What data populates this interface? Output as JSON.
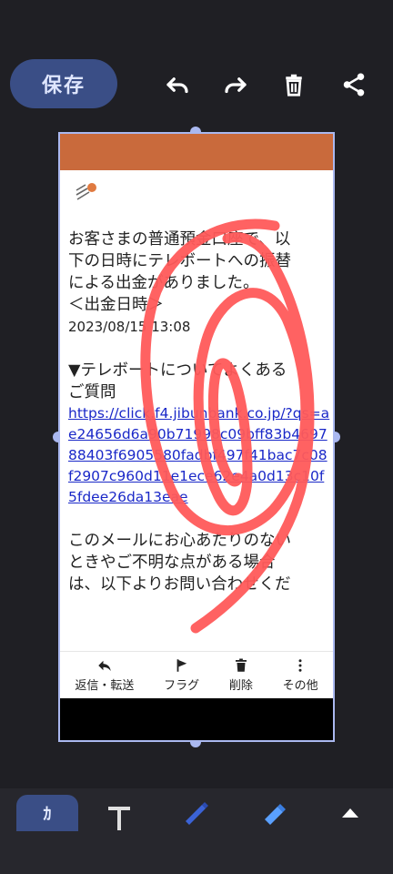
{
  "toolbar": {
    "save_label": "保存",
    "icons": [
      "undo-icon",
      "redo-icon",
      "delete-icon",
      "share-icon"
    ]
  },
  "email": {
    "header_color": "#c96a3c",
    "line1": "お客さまの普通預金口座で、以",
    "line2": "下の日時にテレボートへの振替",
    "line3": "による出金がありました。",
    "line4": "＜出金日時＞",
    "date": "2023/08/15 13:08",
    "line5": "▼テレボートについてよくある",
    "line6": "ご質問",
    "link": "https://click.f4.jibunbank.co.jp/?qs=ae24656d6a90b71998c09bff83b469788403f6905580fadbf497f41bac7c08f2907c960d11e1ece62e4a0d13c10f5fdee26da13eae",
    "line7": "このメールにお心あたりのない",
    "line8": "ときやご不明な点がある場合",
    "line9": "は、以下よりお問い合わせくだ"
  },
  "email_actions": [
    {
      "label": "返信・転送",
      "icon": "reply-icon"
    },
    {
      "label": "フラグ",
      "icon": "flag-icon"
    },
    {
      "label": "削除",
      "icon": "trash-icon"
    },
    {
      "label": "その他",
      "icon": "more-vertical-icon"
    }
  ],
  "bottom_tools": {
    "pen_tab_label": "ｶ",
    "icons": [
      "text-tool-icon",
      "pen-icon",
      "highlighter-icon",
      "expand-up-icon"
    ]
  },
  "colors": {
    "background": "#1f1f24",
    "accent": "#3a4e86",
    "scribble": "#ff5a5a",
    "frame_border": "#aab8f0"
  }
}
